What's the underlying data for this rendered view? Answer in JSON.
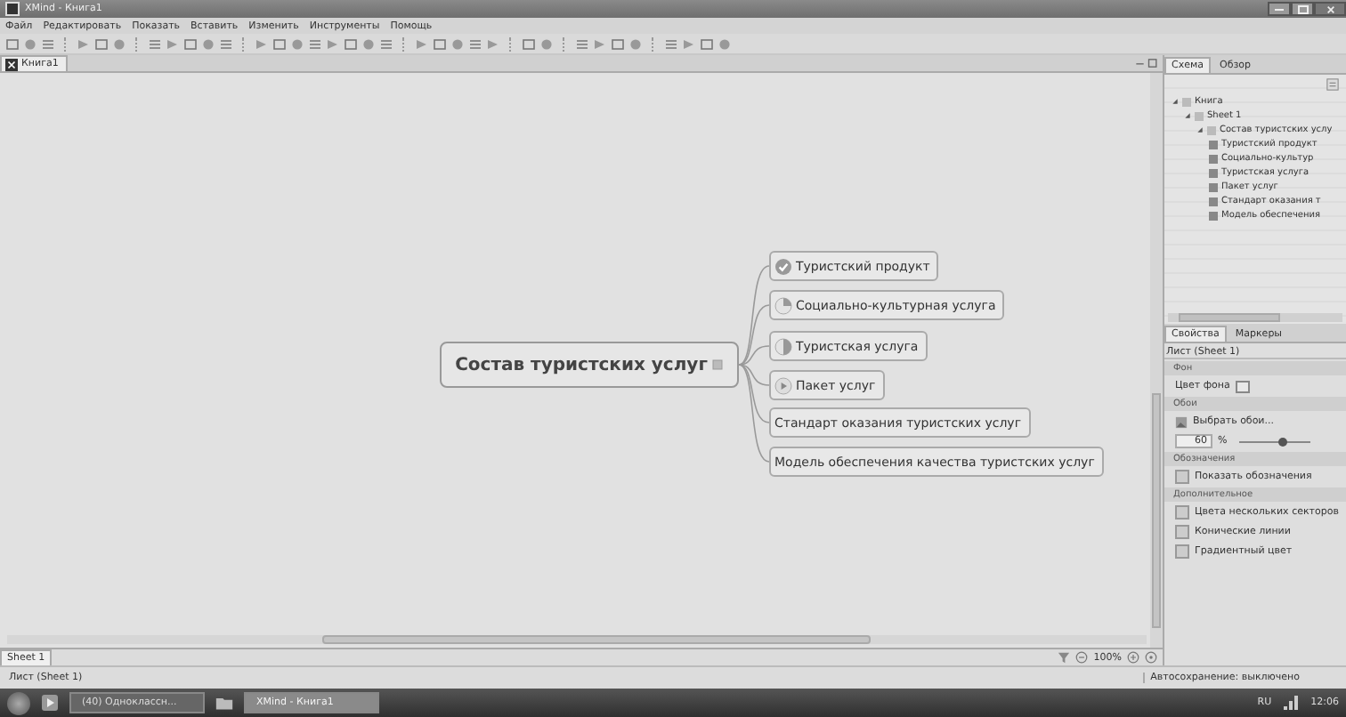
{
  "window": {
    "title": "XMind - Книга1"
  },
  "menu": [
    "Файл",
    "Редактировать",
    "Показать",
    "Вставить",
    "Изменить",
    "Инструменты",
    "Помощь"
  ],
  "editor_tab": {
    "label": "Книга1",
    "selected": true
  },
  "mindmap": {
    "central": "Состав туристских услуг",
    "topics": [
      {
        "text": "Туристский продукт",
        "kind": "done"
      },
      {
        "text": "Социально-культурная услуга",
        "kind": "quarter"
      },
      {
        "text": "Туристская услуга",
        "kind": "half"
      },
      {
        "text": "Пакет услуг",
        "kind": "start"
      },
      {
        "text": "Стандарт оказания туристских услуг",
        "kind": "plain"
      },
      {
        "text": "Модель обеспечения качества туристских услуг",
        "kind": "plain"
      }
    ]
  },
  "sheet_tabs": [
    {
      "label": "Sheet 1",
      "selected": true
    }
  ],
  "zoom": "100%",
  "outline": {
    "tabs": [
      {
        "label": "Схема",
        "selected": true
      },
      {
        "label": "Обзор",
        "selected": false
      }
    ],
    "tree": [
      {
        "label": "Книга",
        "expanded": true,
        "children": [
          {
            "label": "Sheet 1",
            "expanded": true,
            "children": [
              {
                "label": "Состав туристских услу",
                "expanded": true,
                "children": [
                  {
                    "label": "Туристский продукт"
                  },
                  {
                    "label": "Социально-культур"
                  },
                  {
                    "label": "Туристская услуга"
                  },
                  {
                    "label": "Пакет услуг"
                  },
                  {
                    "label": "Стандарт оказания т"
                  },
                  {
                    "label": "Модель обеспечения"
                  }
                ]
              }
            ]
          }
        ]
      }
    ]
  },
  "properties": {
    "tabs": [
      {
        "label": "Свойства",
        "selected": true
      },
      {
        "label": "Маркеры",
        "selected": false
      }
    ],
    "title": "Лист (Sheet 1)",
    "background": {
      "heading": "Фон",
      "color_label": "Цвет фона"
    },
    "wallpaper": {
      "heading": "Обои",
      "choose": "Выбрать обои...",
      "value": "60",
      "unit": "%",
      "level": 0.6
    },
    "legend": {
      "heading": "Обозначения",
      "options": [
        {
          "label": "Показать обозначения",
          "checked": false
        }
      ]
    },
    "advanced": {
      "heading": "Дополнительное",
      "options": [
        {
          "label": "Цвета нескольких секторов",
          "checked": false
        },
        {
          "label": "Конические линии",
          "checked": false
        },
        {
          "label": "Градиентный цвет",
          "checked": false
        }
      ]
    }
  },
  "status_bar": {
    "left": "Лист (Sheet 1)",
    "right": "Автосохранение: выключено"
  },
  "taskbar": {
    "items": [
      {
        "label": "(40) Одноклассн...",
        "selected": false
      },
      {
        "label": "XMind - Книга1",
        "selected": true
      }
    ],
    "language": "RU",
    "time": "12:06"
  }
}
